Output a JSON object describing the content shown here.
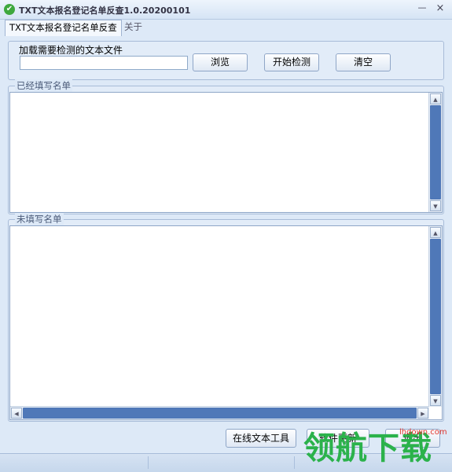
{
  "window": {
    "title": "TXT文本报名登记名单反查1.0.20200101",
    "min_glyph": "—",
    "close_glyph": "×"
  },
  "tabs": [
    {
      "label": "TXT文本报名登记名单反查",
      "active": true
    },
    {
      "label": "关于",
      "active": false
    }
  ],
  "load_section": {
    "label": "加载需要检测的文本文件",
    "file_input": {
      "value": "",
      "placeholder": ""
    },
    "buttons": {
      "browse": "浏览",
      "start": "开始检测",
      "clear": "清空"
    }
  },
  "filled_list": {
    "title": "已经填写名单",
    "items": []
  },
  "unfilled_list": {
    "title": "未填写名单",
    "items": []
  },
  "bottom_buttons": {
    "online_tools": "在线文本工具",
    "software_update": "软件更新",
    "exit": "退出"
  },
  "watermark": {
    "text": "领航下载",
    "domain": "lhdown.com"
  },
  "colors": {
    "background": "#dde9f7",
    "accent": "#4f78b8",
    "watermark_green": "#2bb24b",
    "watermark_red": "#e0342c"
  },
  "icons": {
    "app": "check-circle-icon",
    "minimize": "minimize-icon",
    "close": "close-icon"
  }
}
